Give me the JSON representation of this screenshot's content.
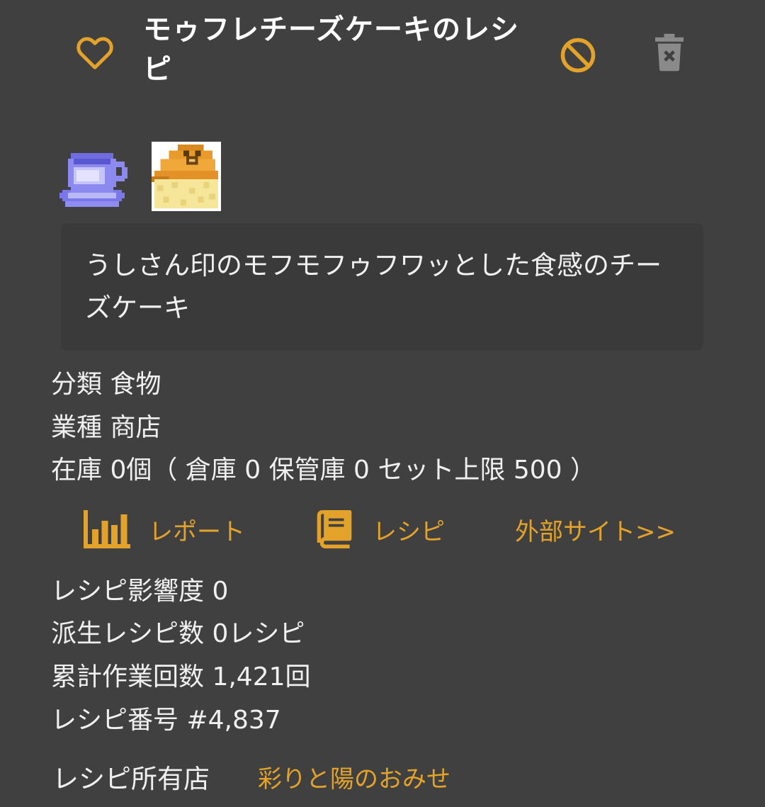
{
  "recipe": {
    "title": "モゥフレチーズケーキのレシピ",
    "description": "うしさん印のモフモフゥフワッとした食感のチーズケーキ"
  },
  "header": {
    "favorite_icon": "heart-outline-icon",
    "block_icon": "block-icon",
    "delete_icon": "trash-icon"
  },
  "images": [
    {
      "name": "teacup-icon"
    },
    {
      "name": "cheesecake-icon"
    }
  ],
  "details": {
    "category": "分類 食物",
    "industry": "業種 商店",
    "stock": "在庫 0個（ 倉庫 0 保管庫 0 セット上限 500 ）"
  },
  "links": {
    "report": {
      "label": "レポート",
      "icon": "bar-chart-icon"
    },
    "recipe": {
      "label": "レシピ",
      "icon": "book-icon"
    },
    "external": {
      "label": "外部サイト>>"
    }
  },
  "stats": {
    "influence": "レシピ影響度 0",
    "derived": "派生レシピ数 0レシピ",
    "total_work": "累計作業回数 1,421回",
    "number": "レシピ番号 #4,837"
  },
  "owner": {
    "label": "レシピ所有店",
    "shop_name": "彩りと陽のおみせ"
  },
  "colors": {
    "background": "#404040",
    "accent": "#e3a32a",
    "desc_box": "#3a3a3a",
    "muted_icon": "#8a8a8a"
  }
}
